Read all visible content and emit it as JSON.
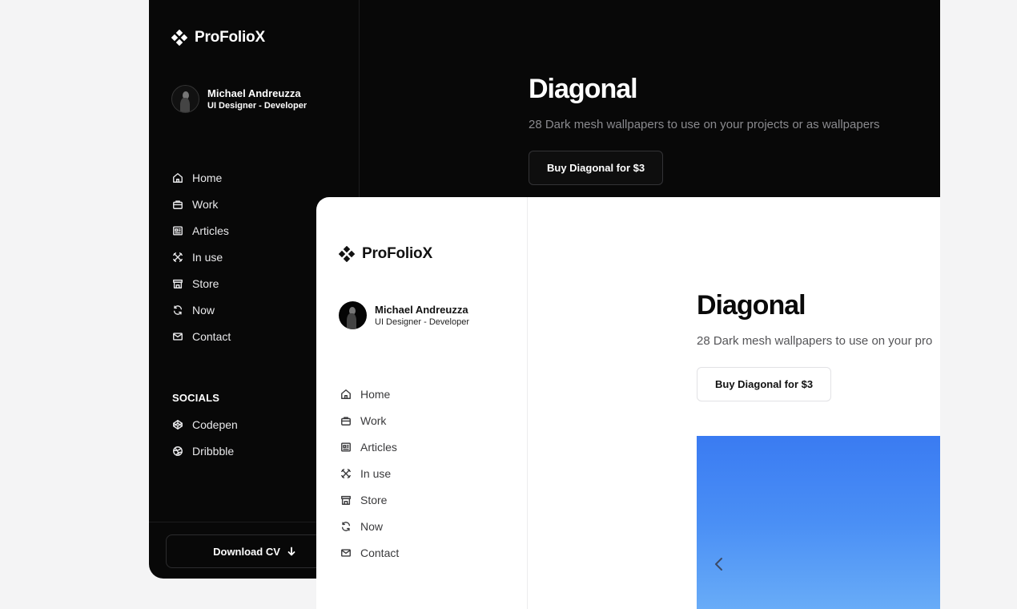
{
  "brand": {
    "name": "ProFolioX"
  },
  "profile": {
    "name": "Michael Andreuzza",
    "role": "UI Designer - Developer"
  },
  "nav": [
    {
      "label": "Home",
      "icon": "home-icon"
    },
    {
      "label": "Work",
      "icon": "briefcase-icon"
    },
    {
      "label": "Articles",
      "icon": "newspaper-icon"
    },
    {
      "label": "In use",
      "icon": "tools-icon"
    },
    {
      "label": "Store",
      "icon": "store-icon"
    },
    {
      "label": "Now",
      "icon": "refresh-icon"
    },
    {
      "label": "Contact",
      "icon": "mail-icon"
    }
  ],
  "socials": {
    "title": "SOCIALS",
    "items": [
      {
        "label": "Codepen",
        "icon": "codepen-icon"
      },
      {
        "label": "Dribbble",
        "icon": "dribbble-icon"
      }
    ]
  },
  "footer": {
    "download_label": "Download CV"
  },
  "hero": {
    "title": "Diagonal",
    "subtitle": "28 Dark mesh wallpapers to use on your projects or as wallpapers",
    "subtitle_light": "28 Dark mesh wallpapers to use on your pro",
    "buy_label": "Buy Diagonal for $3"
  },
  "colors": {
    "dark_bg": "#080808",
    "light_bg": "#ffffff",
    "page_bg": "#f4f4f5",
    "gallery_blue": "#3a7bf2"
  }
}
